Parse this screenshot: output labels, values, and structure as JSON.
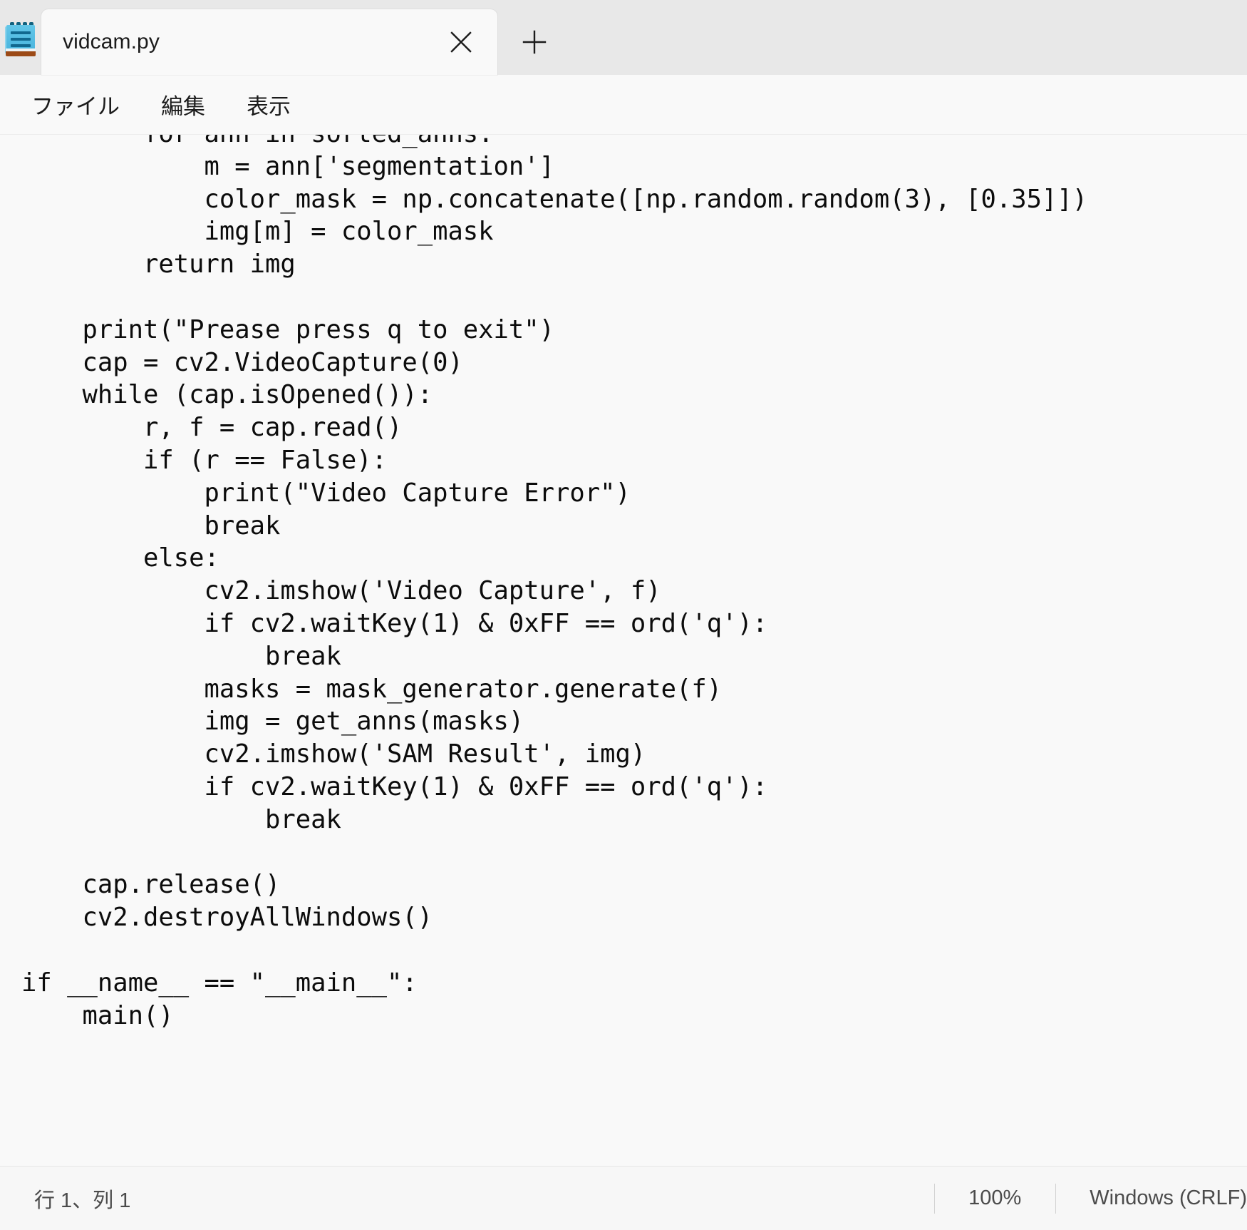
{
  "window": {
    "app_icon": "notepad-icon",
    "background": "#e8e8e8"
  },
  "tabs": [
    {
      "title": "vidcam.py",
      "active": true,
      "close_icon": "close-icon"
    }
  ],
  "new_tab": {
    "icon": "plus-icon",
    "label": "+"
  },
  "menubar": {
    "items": [
      {
        "label": "ファイル"
      },
      {
        "label": "編集"
      },
      {
        "label": "表示"
      }
    ]
  },
  "editor": {
    "content": "        for ann in sorted_anns:\n            m = ann['segmentation']\n            color_mask = np.concatenate([np.random.random(3), [0.35]])\n            img[m] = color_mask\n        return img\n\n    print(\"Prease press q to exit\")\n    cap = cv2.VideoCapture(0)\n    while (cap.isOpened()):\n        r, f = cap.read()\n        if (r == False):\n            print(\"Video Capture Error\")\n            break\n        else:\n            cv2.imshow('Video Capture', f)\n            if cv2.waitKey(1) & 0xFF == ord('q'):\n                break\n            masks = mask_generator.generate(f)\n            img = get_anns(masks)\n            cv2.imshow('SAM Result', img)\n            if cv2.waitKey(1) & 0xFF == ord('q'):\n                break\n\n    cap.release()\n    cv2.destroyAllWindows()\n\nif __name__ == \"__main__\":\n    main()"
  },
  "statusbar": {
    "cursor_position": "行 1、列 1",
    "zoom": "100%",
    "line_ending": "Windows (CRLF)"
  }
}
